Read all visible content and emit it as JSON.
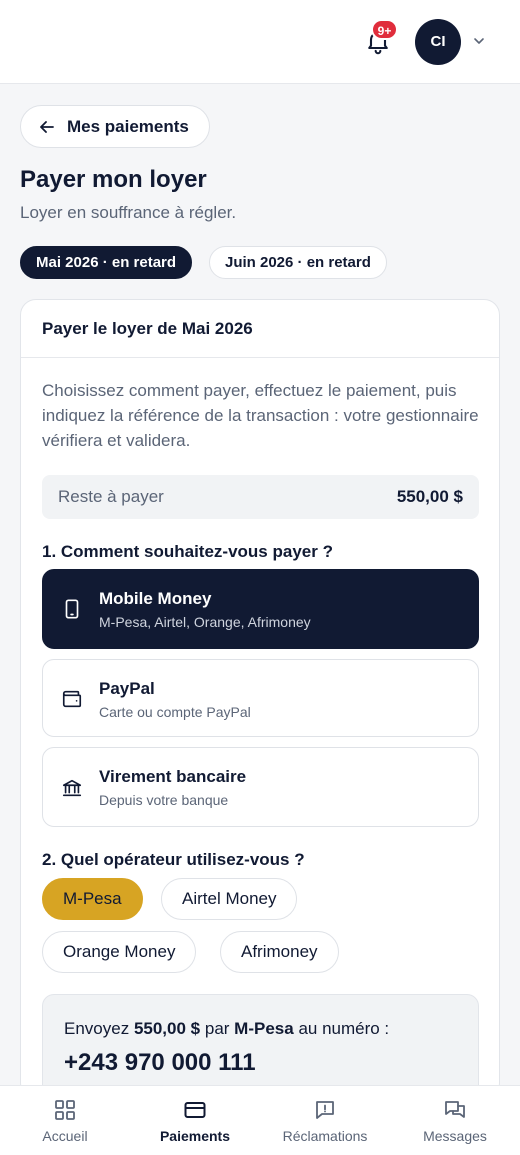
{
  "header": {
    "notifications_badge": "9+",
    "avatar_initials": "CI"
  },
  "back_button": {
    "label": "Mes paiements"
  },
  "page": {
    "title": "Payer mon loyer",
    "subtitle": "Loyer en souffrance à régler."
  },
  "period_chips": [
    {
      "label": "Mai 2026 · en retard",
      "active": true
    },
    {
      "label": "Juin 2026 · en retard",
      "active": false
    }
  ],
  "card": {
    "title": "Payer le loyer de Mai 2026",
    "intro": "Choisissez comment payer, effectuez le paiement, puis indiquez la référence de la transaction : votre gestionnaire vérifiera et validera.",
    "balance_label": "Reste à payer",
    "balance_value": "550,00 $"
  },
  "step1": {
    "label": "1. Comment souhaitez-vous payer ?"
  },
  "methods": [
    {
      "title": "Mobile Money",
      "desc": "M-Pesa, Airtel, Orange, Afrimoney",
      "icon": "phone-icon",
      "selected": true
    },
    {
      "title": "PayPal",
      "desc": "Carte ou compte PayPal",
      "icon": "wallet-icon",
      "selected": false
    },
    {
      "title": "Virement bancaire",
      "desc": "Depuis votre banque",
      "icon": "bank-icon",
      "selected": false
    }
  ],
  "step2": {
    "label": "2. Quel opérateur utilisez-vous ?"
  },
  "operators": [
    {
      "label": "M-Pesa",
      "selected": true
    },
    {
      "label": "Airtel Money",
      "selected": false
    },
    {
      "label": "Orange Money",
      "selected": false
    },
    {
      "label": "Afrimoney",
      "selected": false
    }
  ],
  "instructions": {
    "prefix": "Envoyez",
    "amount": "550,00 $",
    "middle": "par",
    "operator": "M-Pesa",
    "suffix": "au numéro :",
    "phone": "+243 970 000 111"
  },
  "bottom_nav": [
    {
      "label": "Accueil",
      "icon": "grid-icon",
      "active": false
    },
    {
      "label": "Paiements",
      "icon": "card-icon",
      "active": true
    },
    {
      "label": "Réclamations",
      "icon": "alert-message-icon",
      "active": false
    },
    {
      "label": "Messages",
      "icon": "chat-icon",
      "active": false
    }
  ],
  "colors": {
    "navy": "#111a33",
    "accent_gold": "#d7a423",
    "badge_red": "#e02d3c"
  }
}
